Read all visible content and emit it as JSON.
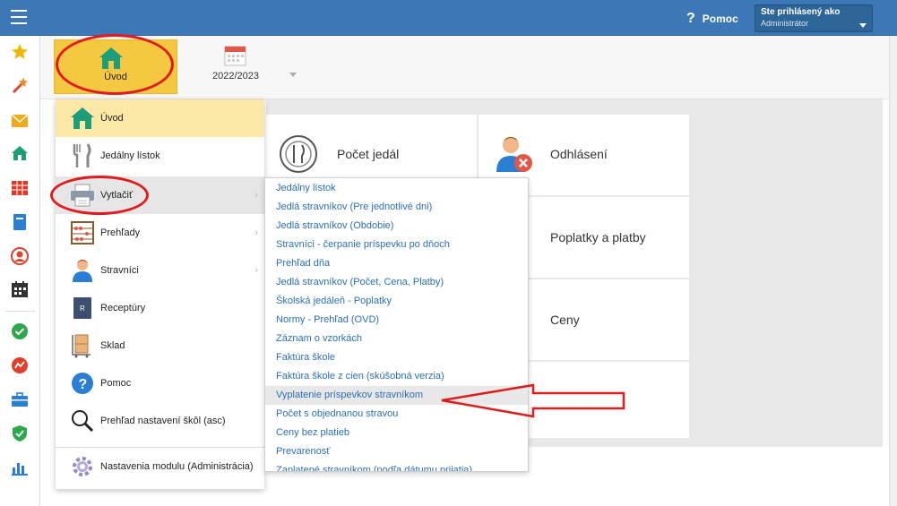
{
  "topbar": {
    "help_label": "Pomoc",
    "user_line1": "Ste prihlásený ako",
    "user_line2": "Administrátor"
  },
  "tabs": [
    {
      "label": "Úvod",
      "icon": "home-icon"
    },
    {
      "label": "2022/2023",
      "icon": "calendar-icon"
    }
  ],
  "sidebar_icons": [
    "star-icon",
    "magic-wand-icon",
    "mail-icon",
    "home-icon",
    "table-icon",
    "book-icon",
    "user-circle-icon",
    "calendar-icon",
    "check-circle-icon",
    "chart-circle-icon",
    "briefcase-icon",
    "shield-check-icon",
    "bar-chart-icon"
  ],
  "menu": {
    "items": [
      {
        "label": "Úvod",
        "icon": "home-icon"
      },
      {
        "label": "Jedálny lístok",
        "icon": "fork-knife-icon"
      },
      {
        "label": "Vytlačiť",
        "icon": "printer-icon"
      },
      {
        "label": "Prehľady",
        "icon": "abacus-icon"
      },
      {
        "label": "Stravníci",
        "icon": "person-icon"
      },
      {
        "label": "Receptúry",
        "icon": "recipe-book-icon"
      },
      {
        "label": "Sklad",
        "icon": "boxes-cart-icon"
      },
      {
        "label": "Pomoc",
        "icon": "help-circle-icon"
      },
      {
        "label": "Prehľad nastavení škôl (asc)",
        "icon": "magnifier-icon"
      },
      {
        "label": "Nastavenia modulu (Administrácia)",
        "icon": "gear-icon"
      }
    ]
  },
  "submenu": {
    "items": [
      "Jedálny lístok",
      "Jedlá stravníkov (Pre jednotlivé dni)",
      "Jedlá stravníkov (Obdobie)",
      "Stravníci - čerpanie príspevku po dňoch",
      "Prehľad dňa",
      "Jedlá stravníkov (Počet, Cena, Platby)",
      "Školská jedáleň - Poplatky",
      "Normy - Prehľad (OVD)",
      "Záznam o vzorkách",
      "Faktúra škole",
      "Faktúra škole z cien (skúšobná verzia)",
      "Vyplatenie príspevkov stravníkom",
      "Počet s objednanou stravou",
      "Ceny bez platieb",
      "Prevarenosť",
      "Zaplatené stravníkom (podľa dátumu prijatia)"
    ]
  },
  "cards": {
    "pocet_jedal": "Počet jedál",
    "odhlasenie": "Odhlásení",
    "poplatky": "Poplatky a platby",
    "ceny": "Ceny"
  },
  "colors": {
    "topbar": "#3c78b5",
    "active_tab": "#f5c842",
    "annotation_red": "#e01b1b",
    "link_blue": "#2c6fb1"
  }
}
